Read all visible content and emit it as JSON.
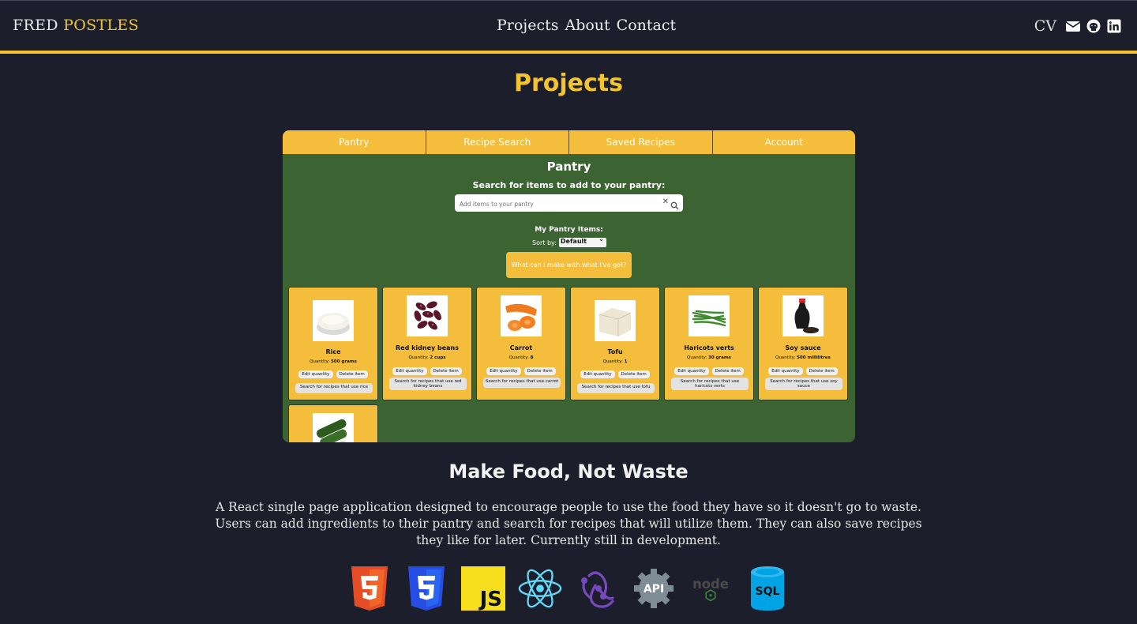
{
  "nav": {
    "brand_first": "FRED",
    "brand_second": "POSTLES",
    "links": [
      "Projects",
      "About",
      "Contact"
    ],
    "cv": "CV",
    "icons": [
      "envelope-icon",
      "github-icon",
      "linkedin-icon"
    ]
  },
  "page": {
    "title": "Projects"
  },
  "preview": {
    "tabs": [
      "Pantry",
      "Recipe Search",
      "Saved Recipes",
      "Account"
    ],
    "app_title": "Pantry",
    "search_label": "Search for items to add to your pantry:",
    "search_placeholder": "Add items to your pantry",
    "my_items": "My Pantry Items:",
    "sort_label": "Sort by:",
    "sort_value": "Default",
    "make_button": "What can I make with what I've got?",
    "edit_label": "Edit quantity",
    "delete_label": "Delete item",
    "items": [
      {
        "name": "Rice",
        "qty_label": "Quantity:",
        "qty": "500 grams",
        "recipe": "Search for recipes that use rice"
      },
      {
        "name": "Red kidney beans",
        "qty_label": "Quantity:",
        "qty": "2 cups",
        "recipe": "Search for recipes that use red kidney beans"
      },
      {
        "name": "Carrot",
        "qty_label": "Quantity:",
        "qty": "8",
        "recipe": "Search for recipes that use carrot"
      },
      {
        "name": "Tofu",
        "qty_label": "Quantity:",
        "qty": "1",
        "recipe": "Search for recipes that use tofu"
      },
      {
        "name": "Haricots verts",
        "qty_label": "Quantity:",
        "qty": "30 grams",
        "recipe": "Search for recipes that use haricots verts"
      },
      {
        "name": "Soy sauce",
        "qty_label": "Quantity:",
        "qty": "500 millilitres",
        "recipe": "Search for recipes that use soy sauce"
      }
    ]
  },
  "project": {
    "title": "Make Food, Not Waste",
    "description": "A React single page application designed to encourage people to use the food they have so it doesn't go to waste. Users can add ingredients to their pantry and search for recipes that will utilize them. They can also save recipes they like for later. Currently still in development."
  },
  "tech": {
    "icons": [
      "html5-icon",
      "css3-icon",
      "javascript-icon",
      "react-icon",
      "redux-icon",
      "api-icon",
      "nodejs-icon",
      "sql-icon"
    ],
    "labels": {
      "js": "JS",
      "api": "API",
      "sql": "SQL",
      "node": "node"
    }
  },
  "colors": {
    "background": "#1c1f2b",
    "accent": "#f4c430",
    "app_green": "#3c6332",
    "card_yellow": "#f4bd3b"
  }
}
